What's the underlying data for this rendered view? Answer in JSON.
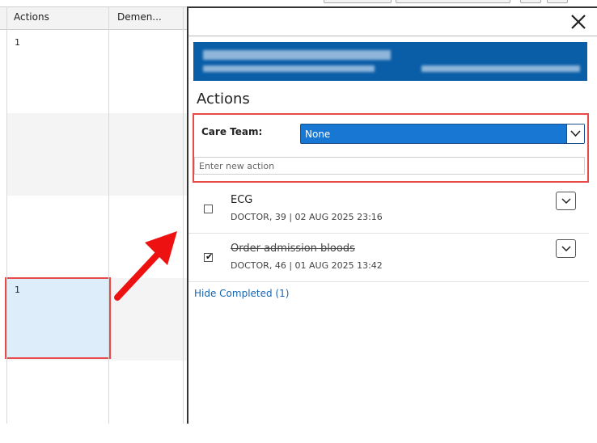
{
  "grid": {
    "columns": [
      "Actions",
      "Demen..."
    ],
    "rows": [
      {
        "actions": "1"
      },
      {
        "actions": ""
      },
      {
        "actions": ""
      },
      {
        "actions": "1"
      },
      {
        "actions": ""
      }
    ]
  },
  "panel": {
    "title": "Actions",
    "care_team": {
      "label": "Care Team:",
      "value": "None"
    },
    "new_action_placeholder": "Enter new action",
    "items": [
      {
        "title": "ECG",
        "meta": "DOCTOR, 39 | 02 AUG 2025 23:16",
        "completed": false
      },
      {
        "title": "Order admission bloods",
        "meta": "DOCTOR, 46 | 01 AUG 2025 13:42",
        "completed": true
      }
    ],
    "hide_completed": "Hide Completed (1)"
  },
  "colors": {
    "highlight_red": "#e84a4a",
    "banner_blue": "#0a5ea8",
    "select_blue": "#1877d2",
    "link_blue": "#1565b0",
    "selected_cell": "#ddeefa"
  }
}
